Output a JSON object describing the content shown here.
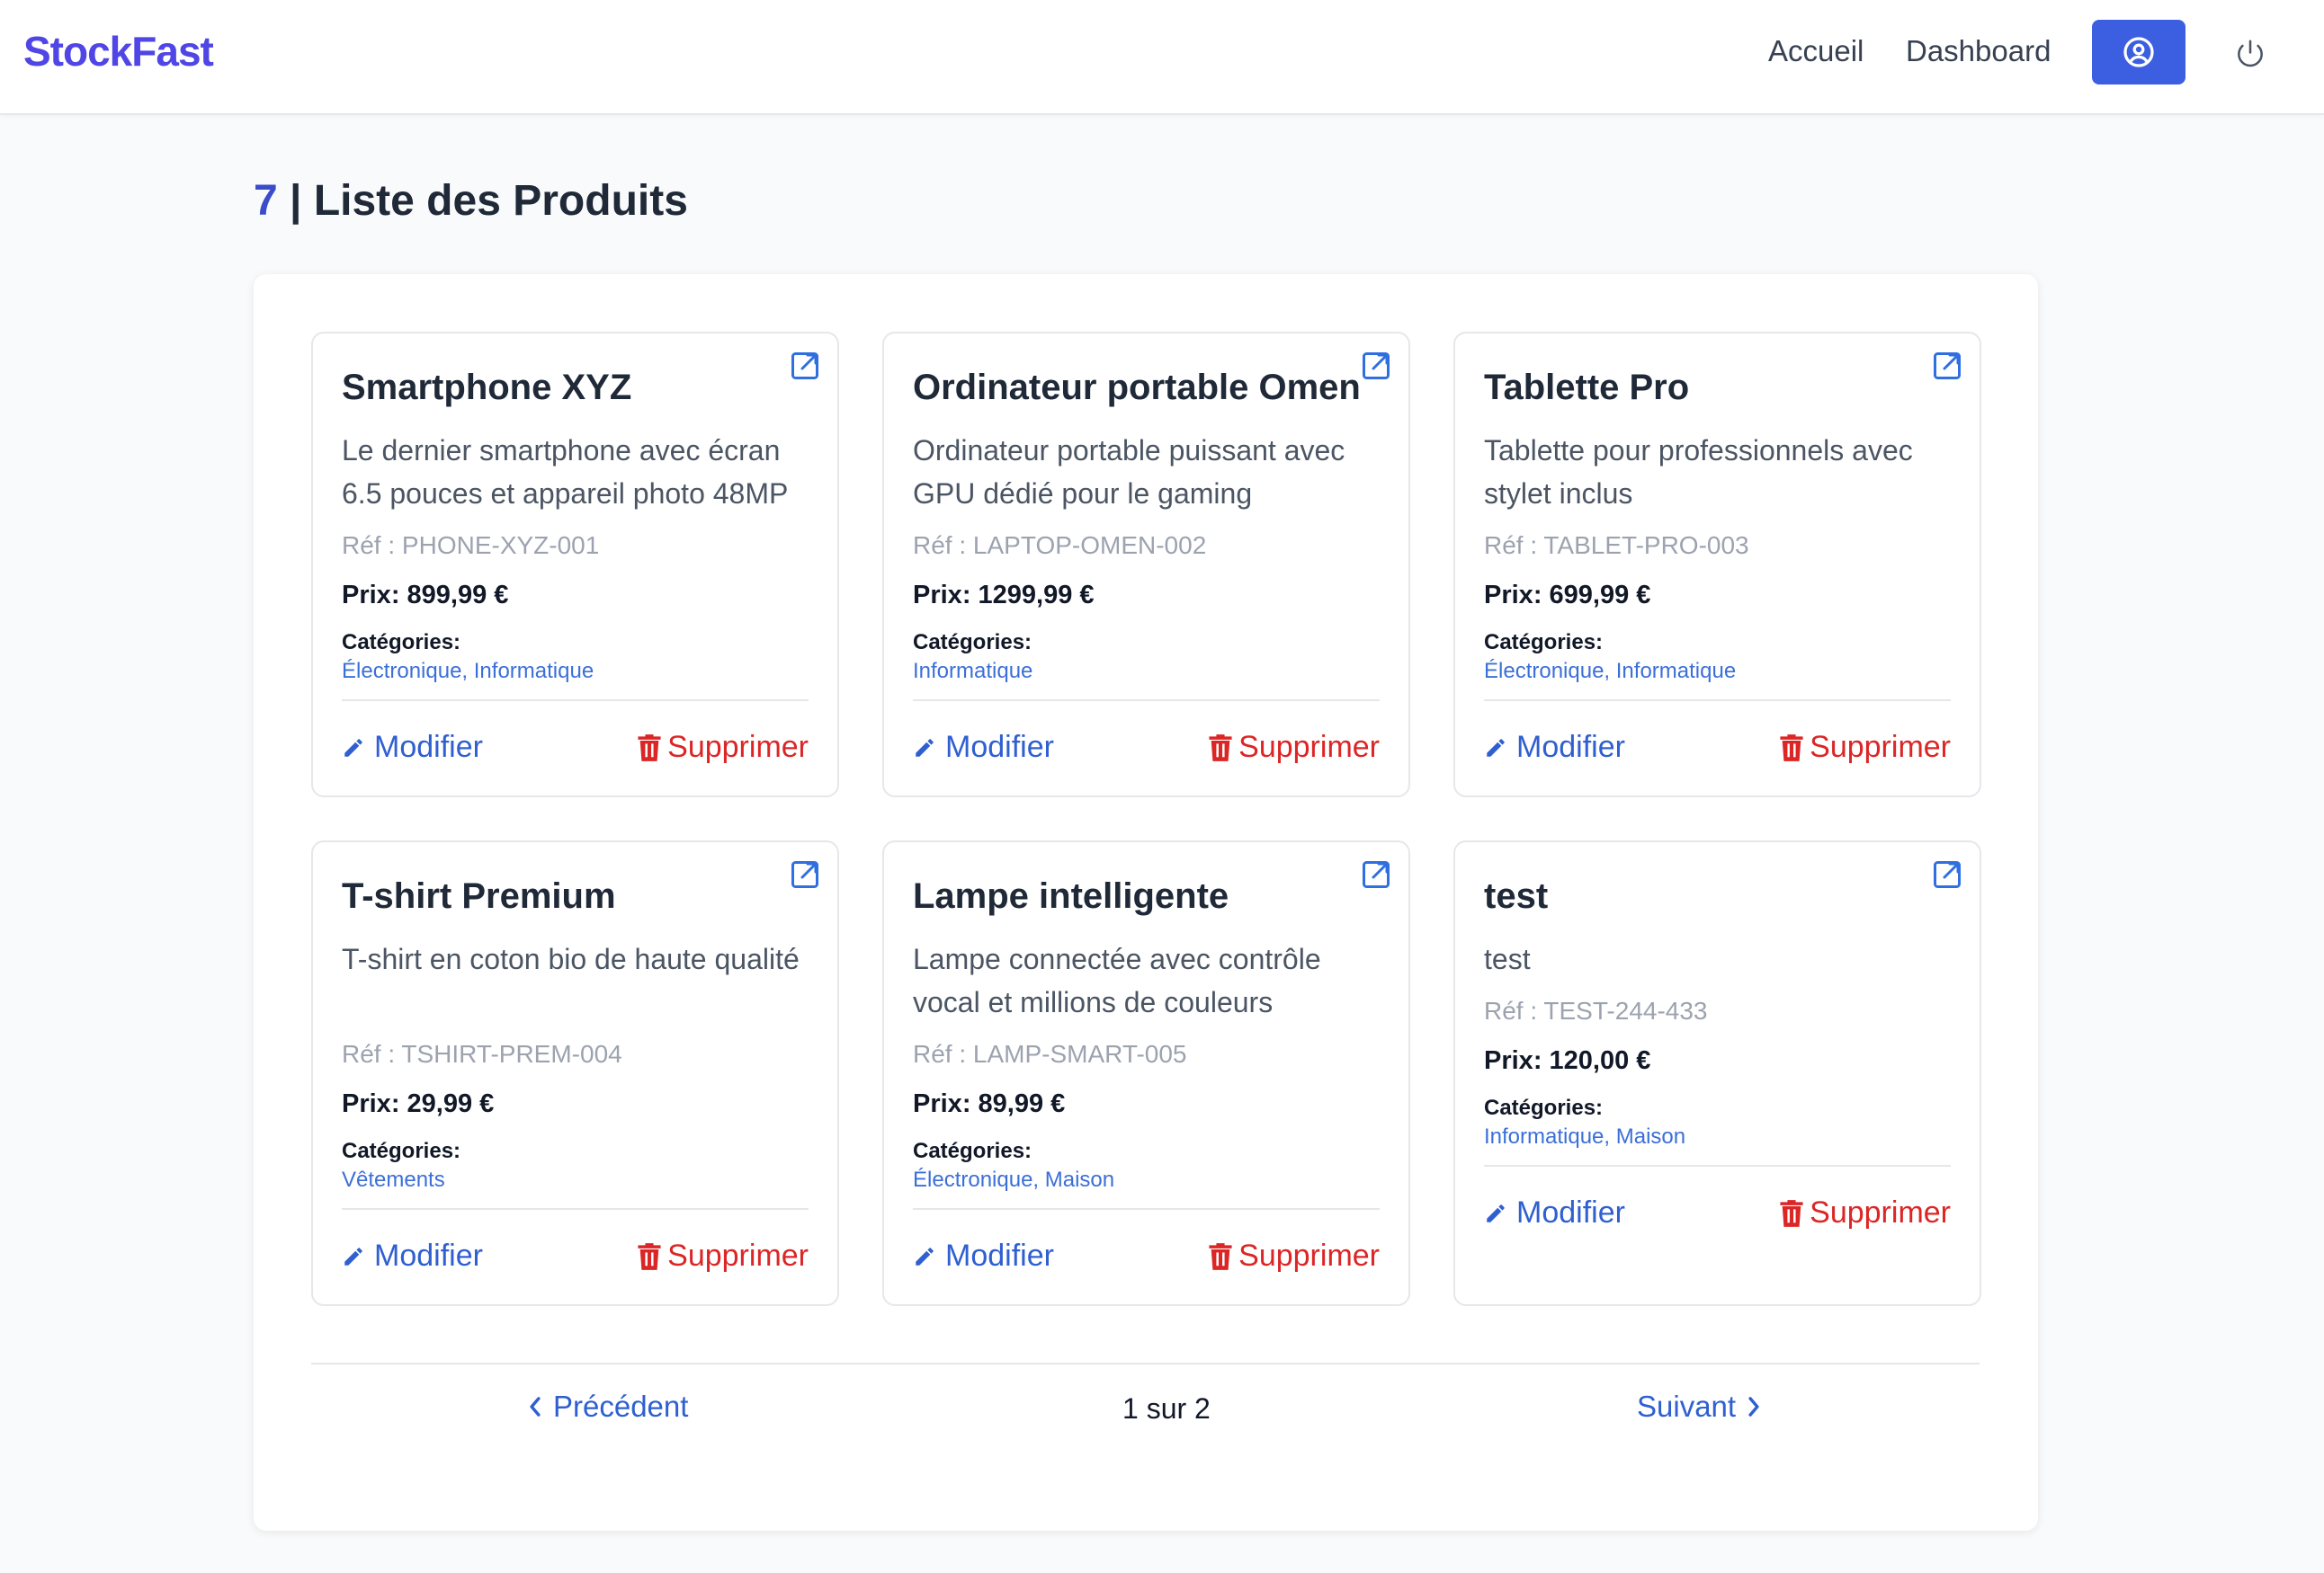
{
  "nav": {
    "brand": "StockFast",
    "links": [
      "Accueil",
      "Dashboard"
    ],
    "profile_icon": "user-circle-icon",
    "logout_icon": "power-icon",
    "accent_color": "#3b5fe0"
  },
  "page": {
    "count": "7",
    "separator": " | ",
    "title": "Liste des Produits"
  },
  "labels": {
    "ref_prefix": "Réf : ",
    "price_prefix": "Prix: ",
    "categories": "Catégories:",
    "edit": "Modifier",
    "delete": "Supprimer"
  },
  "products": [
    {
      "name": "Smartphone XYZ",
      "description": "Le dernier smartphone avec écran 6.5 pouces et appareil photo 48MP",
      "ref": "PHONE-XYZ-001",
      "price": "899,99 €",
      "categories": "Électronique, Informatique"
    },
    {
      "name": "Ordinateur portable Omen",
      "description": "Ordinateur portable puissant avec GPU dédié pour le gaming",
      "ref": "LAPTOP-OMEN-002",
      "price": "1299,99 €",
      "categories": "Informatique"
    },
    {
      "name": "Tablette Pro",
      "description": "Tablette pour professionnels avec stylet inclus",
      "ref": "TABLET-PRO-003",
      "price": "699,99 €",
      "categories": "Électronique, Informatique"
    },
    {
      "name": "T-shirt Premium",
      "description": "T-shirt en coton bio de haute qualité",
      "ref": "TSHIRT-PREM-004",
      "price": "29,99 €",
      "categories": "Vêtements"
    },
    {
      "name": "Lampe intelligente",
      "description": "Lampe connectée avec contrôle vocal et millions de couleurs",
      "ref": "LAMP-SMART-005",
      "price": "89,99 €",
      "categories": "Électronique, Maison"
    },
    {
      "name": "test",
      "description": "test",
      "ref": "TEST-244-433",
      "price": "120,00 €",
      "categories": "Informatique, Maison"
    }
  ],
  "pagination": {
    "previous": "Précédent",
    "info": "1 sur 2",
    "next": "Suivant"
  },
  "colors": {
    "link_blue": "#2f5fd0",
    "delete_red": "#dc2626",
    "brand_purple": "#4f46e5"
  }
}
